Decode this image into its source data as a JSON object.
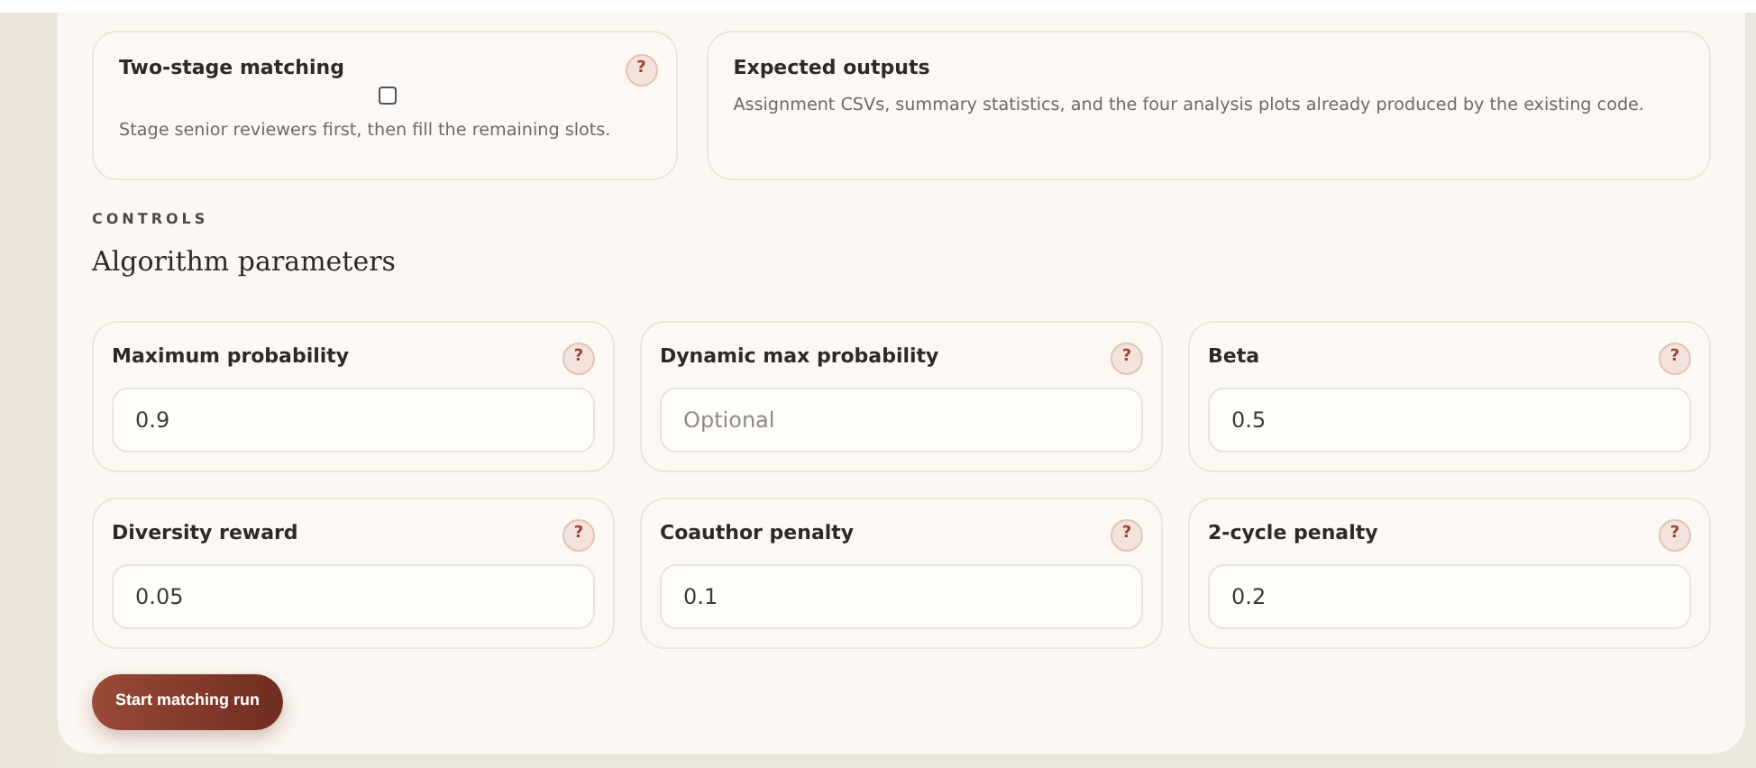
{
  "info_cards": [
    {
      "kind": "toggle",
      "title": "Two-stage matching",
      "help": "?",
      "checked": false,
      "description": "Stage senior reviewers first, then fill the remaining slots."
    },
    {
      "kind": "note",
      "title": "Expected outputs",
      "description": "Assignment CSVs, summary statistics, and the four analysis plots already produced by the existing code."
    }
  ],
  "section": {
    "eyebrow": "CONTROLS",
    "title": "Algorithm parameters"
  },
  "parameters": [
    {
      "label": "Maximum probability",
      "help": "?",
      "value": "0.9"
    },
    {
      "label": "Dynamic max probability",
      "help": "?",
      "placeholder": "Optional"
    },
    {
      "label": "Beta",
      "help": "?",
      "value": "0.5"
    },
    {
      "label": "Diversity reward",
      "help": "?",
      "value": "0.05"
    },
    {
      "label": "Coauthor penalty",
      "help": "?",
      "value": "0.1"
    },
    {
      "label": "2-cycle penalty",
      "help": "?",
      "value": "0.2"
    }
  ],
  "submit": "Start matching run"
}
